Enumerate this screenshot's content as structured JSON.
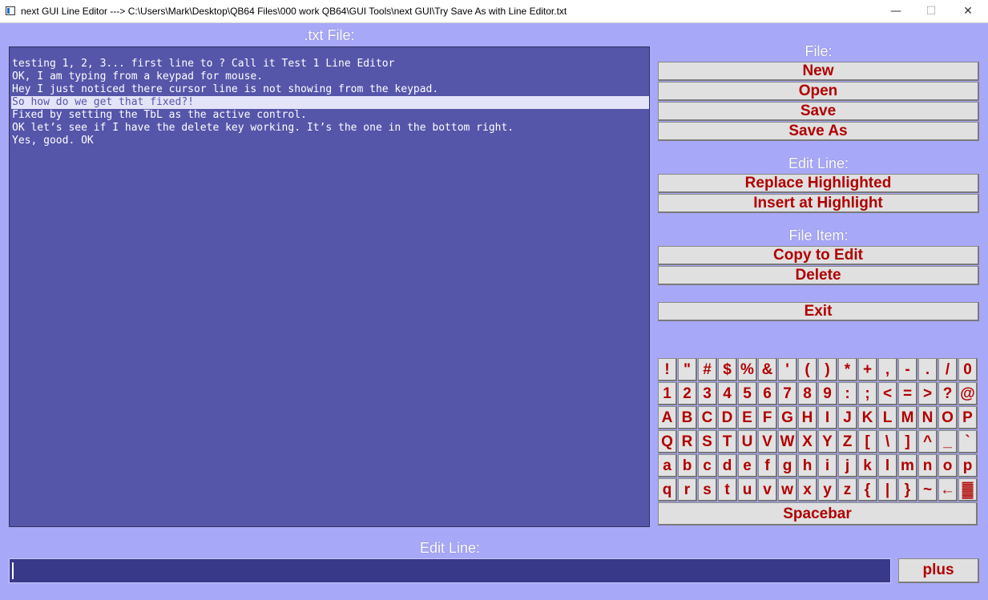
{
  "window": {
    "title": "next GUI Line Editor ---> C:\\Users\\Mark\\Desktop\\QB64 Files\\000 work QB64\\GUI Tools\\next GUI\\Try Save As with Line Editor.txt",
    "minimize_glyph": "—",
    "maximize_glyph": "☐",
    "close_glyph": "✕"
  },
  "textbox": {
    "label": ".txt File:",
    "lines": [
      "testing 1, 2, 3... first line to ? Call it Test 1 Line Editor",
      "OK, I am typing from a keypad for mouse.",
      "Hey I just noticed there cursor line is not showing from the keypad.",
      "So how do we get that fixed?!",
      "Fixed by setting the TbL as the active control.",
      "OK let’s see if I have the delete key working. It’s the one in the bottom right.",
      "Yes, good. OK"
    ],
    "highlighted_index": 3
  },
  "file_section": {
    "label": "File:",
    "new": "New",
    "open": "Open",
    "save": "Save",
    "save_as": "Save As"
  },
  "edit_section": {
    "label": "Edit Line:",
    "replace": "Replace Highlighted",
    "insert": "Insert at Highlight"
  },
  "item_section": {
    "label": "File Item:",
    "copy": "Copy to Edit",
    "delete": "Delete"
  },
  "exit": "Exit",
  "keypad": {
    "rows": [
      [
        "!",
        "\"",
        "#",
        "$",
        "%",
        "&",
        "'",
        "(",
        ")",
        "*",
        "+",
        ",",
        "-",
        ".",
        "/",
        "0"
      ],
      [
        "1",
        "2",
        "3",
        "4",
        "5",
        "6",
        "7",
        "8",
        "9",
        ":",
        ";",
        "<",
        "=",
        ">",
        "?",
        "@"
      ],
      [
        "A",
        "B",
        "C",
        "D",
        "E",
        "F",
        "G",
        "H",
        "I",
        "J",
        "K",
        "L",
        "M",
        "N",
        "O",
        "P"
      ],
      [
        "Q",
        "R",
        "S",
        "T",
        "U",
        "V",
        "W",
        "X",
        "Y",
        "Z",
        "[",
        "\\",
        "]",
        "^",
        "_",
        "`"
      ],
      [
        "a",
        "b",
        "c",
        "d",
        "e",
        "f",
        "g",
        "h",
        "i",
        "j",
        "k",
        "l",
        "m",
        "n",
        "o",
        "p"
      ],
      [
        "q",
        "r",
        "s",
        "t",
        "u",
        "v",
        "w",
        "x",
        "y",
        "z",
        "{",
        "|",
        "}",
        "~",
        "←",
        "▓"
      ]
    ],
    "spacebar": "Spacebar"
  },
  "edit_line": {
    "label": "Edit Line:",
    "value": ""
  },
  "plus_button": "plus"
}
